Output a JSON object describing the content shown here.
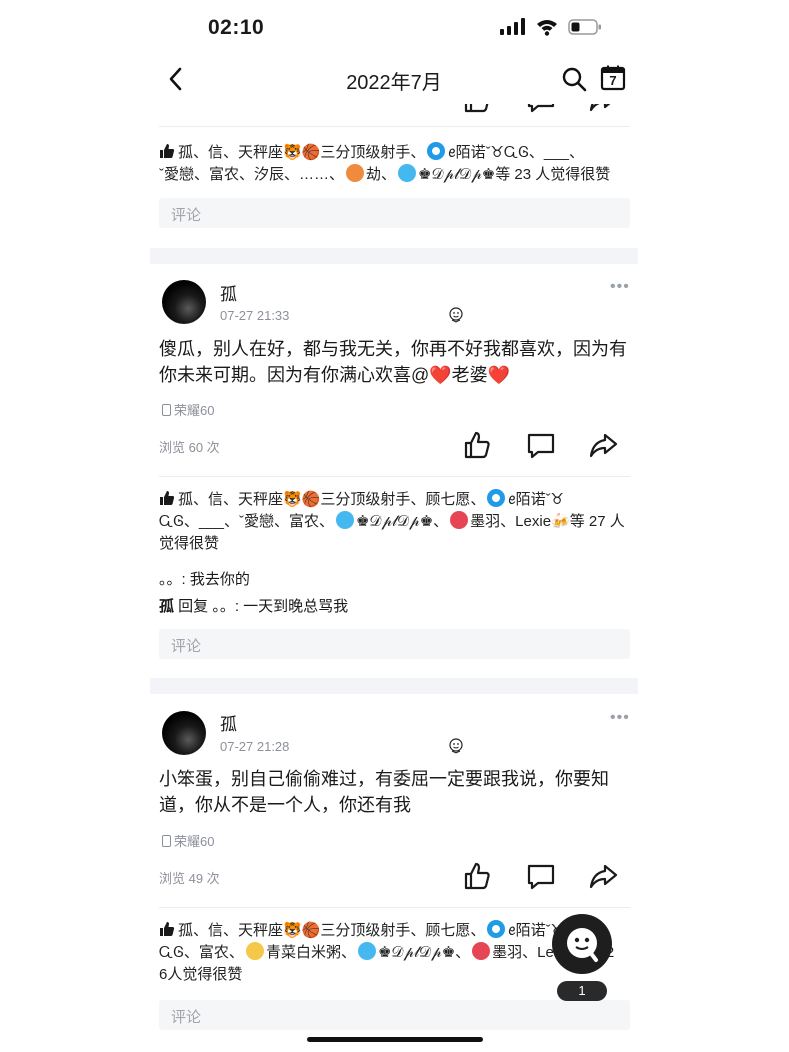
{
  "status": {
    "time": "02:10"
  },
  "nav": {
    "title": "2022年7月",
    "calendar_day": "7"
  },
  "colors": {
    "accent": "#1f8fe8",
    "like_blue": "#29a5e6",
    "heart": "#e6333f"
  },
  "top_post_tail": {
    "likes_text_1": "孤、信、天秤座🐯🏀三分顶级射手、",
    "likes_text_2": "ꫀ陌诺ˇ♉ᏩᎶ、___、",
    "likes_text_3": "ˇ愛戀、富农、汐辰、……、",
    "likes_text_4": "劫、",
    "likes_text_5": "♚𝒟𝓅𝓁𝒟𝓅♚等 23 人觉得很赞",
    "comment_placeholder": "评论"
  },
  "posts": [
    {
      "author": "孤",
      "time": "07-27 21:33",
      "content": "傻瓜，别人在好，都与我无关，你再不好我都喜欢，因为有你未来可期。因为有你满心欢喜@❤️老婆❤️",
      "device": "荣耀60",
      "views": "浏览 60 次",
      "likes_text_1": "孤、信、天秤座🐯🏀三分顶级射手、顾七愿、",
      "likes_text_2": "ꫀ陌诺ˇ♉",
      "likes_text_3": "ᏩᎶ、___、ˇ愛戀、富农、",
      "likes_text_4": "♚𝒟𝓅𝓁𝒟𝓅♚、",
      "likes_text_5": "墨羽、Lexie🍻等 27 人",
      "likes_text_6": "觉得很赞",
      "comment_1": "。。: 我去你的",
      "reply_author": "孤",
      "reply_text": " 回复 。。: 一天到晚总骂我",
      "comment_placeholder": "评论"
    },
    {
      "author": "孤",
      "time": "07-27 21:28",
      "content": "小笨蛋，别自己偷偷难过，有委屈一定要跟我说，你要知道，你从不是一个人，你还有我",
      "device": "荣耀60",
      "views": "浏览 49 次",
      "likes_text_1": "孤、信、天秤座🐯🏀三分顶级射手、顾七愿、",
      "likes_text_2": "ꫀ陌诺ˇ♉",
      "likes_text_3": "ᏩᎶ、富农、",
      "likes_text_4": "青菜白米粥、",
      "likes_text_5": "♚𝒟𝓅𝓁𝒟𝓅♚、",
      "likes_text_6": "墨羽、Le",
      "likes_text_7": "2",
      "likes_text_8": "6人觉得很赞",
      "comment_placeholder": "评论"
    }
  ],
  "floating": {
    "count": "1"
  }
}
